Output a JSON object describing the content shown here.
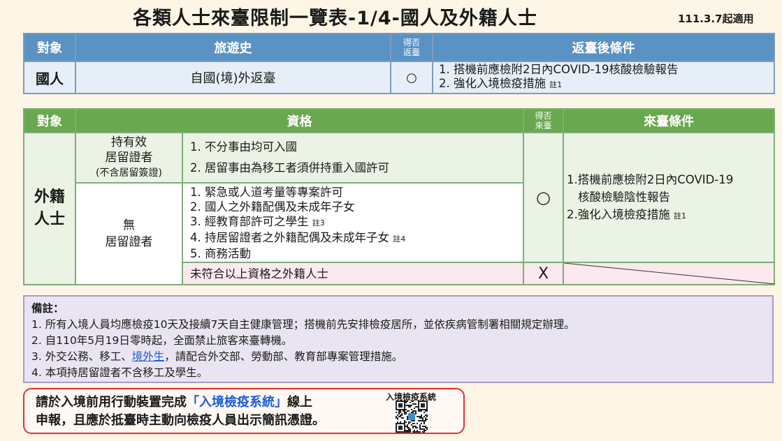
{
  "title": "各類人士來臺限制一覽表-1/4-國人及外籍人士",
  "effective_date": "111.3.7起適用",
  "citizens_table": {
    "headers": [
      "對象",
      "旅遊史",
      "得否返臺",
      "返臺後條件"
    ],
    "header_allowed_line1": "得否",
    "header_allowed_line2": "返臺",
    "row": {
      "subject": "國人",
      "history": "自國(境)外返臺",
      "allowed": "○",
      "conditions": [
        "1.  搭機前應檢附2日內COVID-19核酸檢驗報告",
        "2.  強化入境檢疫措施"
      ],
      "note_ref": "註1"
    }
  },
  "foreigners_table": {
    "headers": [
      "對象",
      "資格",
      "得否來臺",
      "來臺條件"
    ],
    "header_allowed_line1": "得否",
    "header_allowed_line2": "來臺",
    "subject_line1": "外籍",
    "subject_line2": "人士",
    "resident_card_label": [
      "持有效",
      "居留證者",
      "(不含居留簽證)"
    ],
    "resident_items": [
      "1.  不分事由均可入國",
      "2.  居留事由為移工者須併持重入國許可"
    ],
    "no_card_label": [
      "無",
      "居留證者"
    ],
    "no_card_items": [
      "1.  緊急或人道考量等專案許可",
      "2.  國人之外籍配偶及未成年子女",
      "3.  經教育部許可之學生",
      "4.  持居留證者之外籍配偶及未成年子女",
      "5.  商務活動"
    ],
    "no_card_notes": [
      "",
      "",
      "註3",
      "註4",
      ""
    ],
    "allowed": "○",
    "conditions": [
      "1.搭機前應檢附2日內COVID-19",
      "核酸檢驗陰性報告",
      "2.強化入境檢疫措施"
    ],
    "conditions_note": "註1",
    "other_label": "未符合以上資格之外籍人士",
    "other_allowed": "X"
  },
  "notes": {
    "heading": "備註：",
    "items": [
      "1.   所有入境人員均應檢疫10天及接續7天自主健康管理；搭機前先安排檢疫居所，並依疾病管制署相關規定辦理。",
      "2.   自110年5月19日零時起，全面禁止旅客來臺轉機。",
      "4.   本項持居留證者不含移工及學生。"
    ],
    "item3_prefix": "3.   外交公務、移工、",
    "item3_link": "境外生",
    "item3_suffix": "，請配合外交部、勞動部、教育部專案管理措施。"
  },
  "callout": {
    "line1_prefix": "請於入境前用行動裝置完成",
    "system_name": "「入境檢疫系統」",
    "line1_suffix": "線上",
    "line2": "申報，且應於抵臺時主動向檢疫人員出示簡訊憑證。",
    "qr_label": "入境檢疫系統"
  },
  "colors": {
    "blue_header": "#5b92c4",
    "green_header": "#6aa84f",
    "notes_bg": "#e9e4f1",
    "callout_border": "#e03030"
  }
}
